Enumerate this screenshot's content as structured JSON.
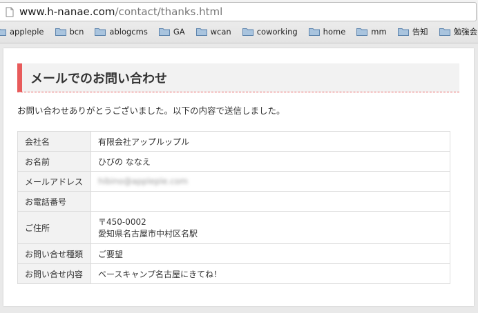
{
  "browser": {
    "url_domain": "www.h-nanae.com",
    "url_path": "/contact/thanks.html",
    "bookmarks": [
      "appleple",
      "bcn",
      "ablogcms",
      "GA",
      "wcan",
      "coworking",
      "home",
      "mm",
      "告知",
      "勉強会"
    ]
  },
  "page": {
    "heading": "メールでのお問い合わせ",
    "lead": "お問い合わせありがとうございました。以下の内容で送信しました。",
    "rows": [
      {
        "label": "会社名",
        "value": "有限会社アップルップル"
      },
      {
        "label": "お名前",
        "value": "ひびの ななえ"
      },
      {
        "label": "メールアドレス",
        "value": "hibino@appleple.com"
      },
      {
        "label": "お電話番号",
        "value": ""
      },
      {
        "label": "ご住所",
        "value_line1": "〒450-0002",
        "value_line2": "愛知県名古屋市中村区名駅"
      },
      {
        "label": "お問い合せ種類",
        "value": "ご要望"
      },
      {
        "label": "お問い合せ内容",
        "value": "ベースキャンプ名古屋にきてね！"
      }
    ]
  },
  "colors": {
    "accent": "#e85b5b",
    "header_bg": "#f2f2f2"
  }
}
